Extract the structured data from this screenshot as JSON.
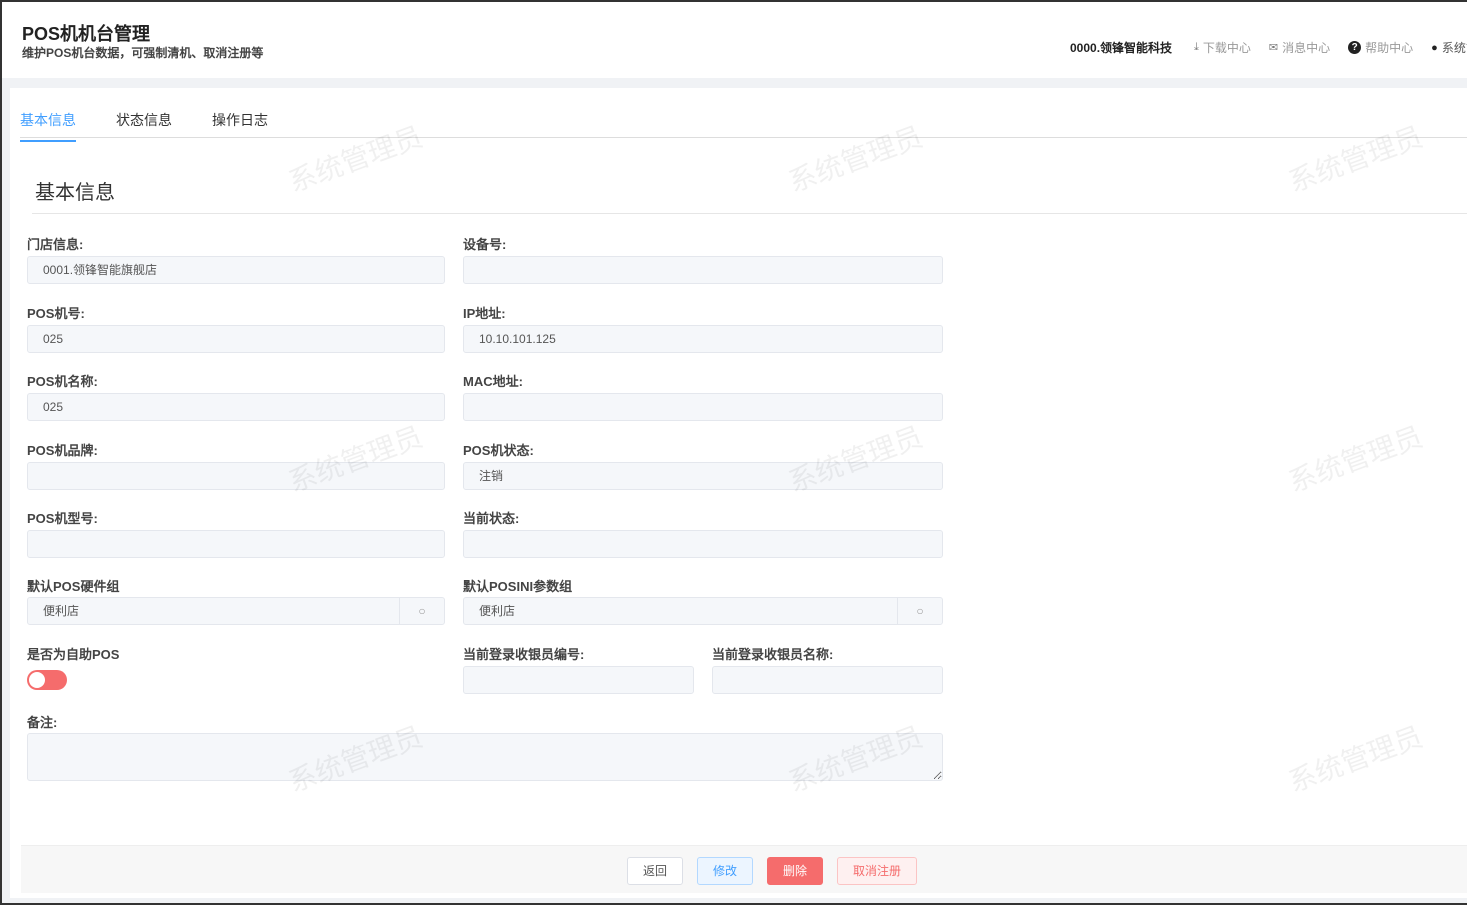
{
  "header": {
    "title": "POS机机台管理",
    "subtitle": "维护POS机台数据，可强制清机、取消注册等",
    "org": "0000.领锋智能科技",
    "download": "下载中心",
    "messages": "消息中心",
    "help": "帮助中心",
    "user": "系统管理员"
  },
  "tabs": [
    "基本信息",
    "状态信息",
    "操作日志"
  ],
  "section_title": "基本信息",
  "fields": {
    "store": {
      "label": "门店信息:",
      "value": "0001.领锋智能旗舰店"
    },
    "device_no": {
      "label": "设备号:",
      "value": ""
    },
    "pos_no": {
      "label": "POS机号:",
      "value": "025"
    },
    "ip": {
      "label": "IP地址:",
      "value": "10.10.101.125"
    },
    "pos_name": {
      "label": "POS机名称:",
      "value": "025"
    },
    "mac": {
      "label": "MAC地址:",
      "value": ""
    },
    "brand": {
      "label": "POS机品牌:",
      "value": ""
    },
    "pos_status": {
      "label": "POS机状态:",
      "value": "注销"
    },
    "model": {
      "label": "POS机型号:",
      "value": ""
    },
    "current_status": {
      "label": "当前状态:",
      "value": ""
    },
    "hw_group": {
      "label": "默认POS硬件组",
      "value": "便利店"
    },
    "ini_group": {
      "label": "默认POSINI参数组",
      "value": "便利店"
    },
    "self_pos": {
      "label": "是否为自助POS",
      "value": true
    },
    "cashier_no": {
      "label": "当前登录收银员编号:",
      "value": ""
    },
    "cashier_name": {
      "label": "当前登录收银员名称:",
      "value": ""
    },
    "remark": {
      "label": "备注:",
      "value": ""
    }
  },
  "buttons": {
    "back": "返回",
    "edit": "修改",
    "delete": "删除",
    "unregister": "取消注册"
  },
  "watermark": "系统管理员"
}
